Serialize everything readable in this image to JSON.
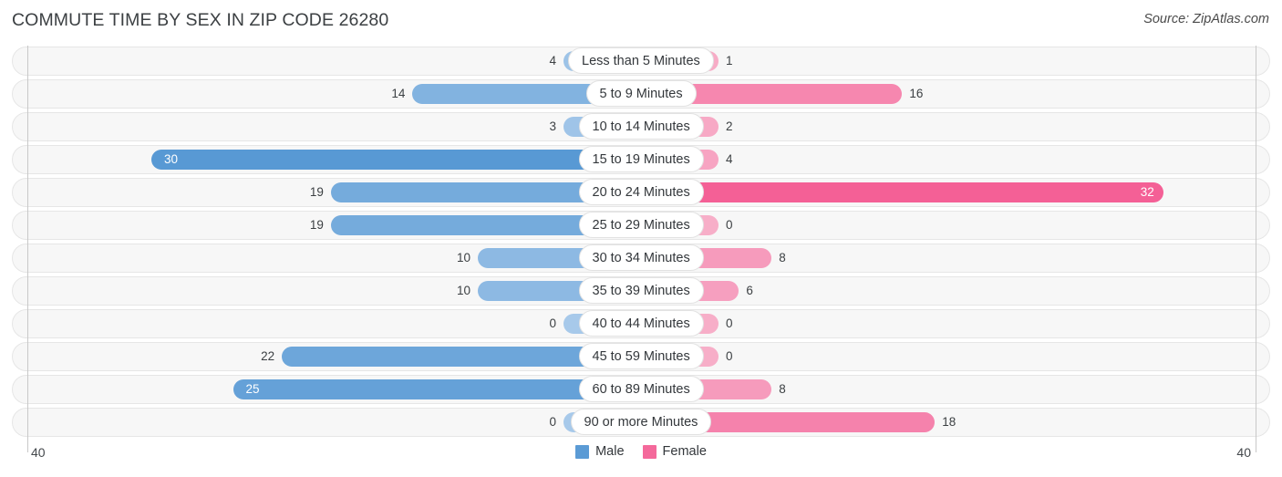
{
  "header": {
    "title": "COMMUTE TIME BY SEX IN ZIP CODE 26280",
    "source": "Source: ZipAtlas.com"
  },
  "legend": {
    "male_label": "Male",
    "female_label": "Female",
    "male_color": "#5b9bd5",
    "female_color": "#f4699b"
  },
  "axis": {
    "left_label": "40",
    "right_label": "40",
    "max": 40
  },
  "chart_data": {
    "type": "bar",
    "subtype": "diverging-bidirectional",
    "title": "COMMUTE TIME BY SEX IN ZIP CODE 26280",
    "xlabel": "",
    "ylabel": "",
    "xlim": [
      40,
      40
    ],
    "grid": false,
    "legend_position": "bottom-center",
    "categories": [
      "Less than 5 Minutes",
      "5 to 9 Minutes",
      "10 to 14 Minutes",
      "15 to 19 Minutes",
      "20 to 24 Minutes",
      "25 to 29 Minutes",
      "30 to 34 Minutes",
      "35 to 39 Minutes",
      "40 to 44 Minutes",
      "45 to 59 Minutes",
      "60 to 89 Minutes",
      "90 or more Minutes"
    ],
    "series": [
      {
        "name": "Male",
        "direction": "left",
        "color": "#5b9bd5",
        "values": [
          4,
          14,
          3,
          30,
          19,
          19,
          10,
          10,
          0,
          22,
          25,
          0
        ]
      },
      {
        "name": "Female",
        "direction": "right",
        "color": "#f4699b",
        "values": [
          1,
          16,
          2,
          4,
          32,
          0,
          8,
          6,
          0,
          0,
          8,
          18
        ]
      }
    ]
  },
  "rows": [
    {
      "label": "Less than 5 Minutes",
      "male": 4,
      "female": 1,
      "male_text": "4",
      "female_text": "1"
    },
    {
      "label": "5 to 9 Minutes",
      "male": 14,
      "female": 16,
      "male_text": "14",
      "female_text": "16"
    },
    {
      "label": "10 to 14 Minutes",
      "male": 3,
      "female": 2,
      "male_text": "3",
      "female_text": "2"
    },
    {
      "label": "15 to 19 Minutes",
      "male": 30,
      "female": 4,
      "male_text": "30",
      "female_text": "4"
    },
    {
      "label": "20 to 24 Minutes",
      "male": 19,
      "female": 32,
      "male_text": "19",
      "female_text": "32"
    },
    {
      "label": "25 to 29 Minutes",
      "male": 19,
      "female": 0,
      "male_text": "19",
      "female_text": "0"
    },
    {
      "label": "30 to 34 Minutes",
      "male": 10,
      "female": 8,
      "male_text": "10",
      "female_text": "8"
    },
    {
      "label": "35 to 39 Minutes",
      "male": 10,
      "female": 6,
      "male_text": "10",
      "female_text": "6"
    },
    {
      "label": "40 to 44 Minutes",
      "male": 0,
      "female": 0,
      "male_text": "0",
      "female_text": "0"
    },
    {
      "label": "45 to 59 Minutes",
      "male": 22,
      "female": 0,
      "male_text": "22",
      "female_text": "0"
    },
    {
      "label": "60 to 89 Minutes",
      "male": 25,
      "female": 8,
      "male_text": "25",
      "female_text": "8"
    },
    {
      "label": "90 or more Minutes",
      "male": 0,
      "female": 18,
      "male_text": "0",
      "female_text": "18"
    }
  ]
}
